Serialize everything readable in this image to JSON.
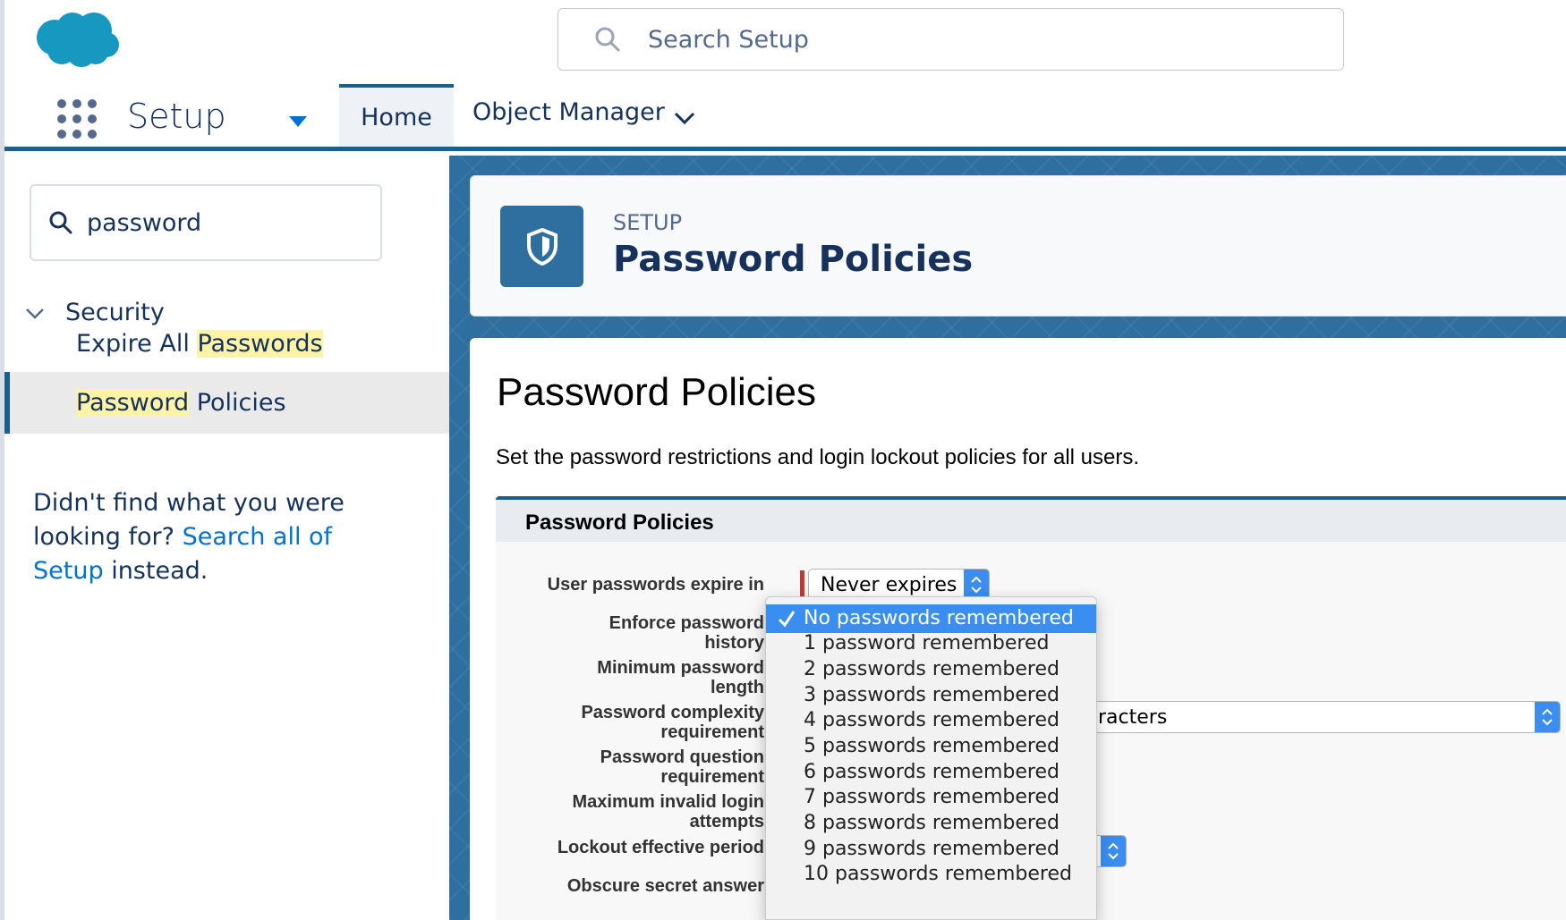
{
  "global_header": {
    "search_placeholder": "Search Setup"
  },
  "context_bar": {
    "app_name": "Setup",
    "tabs": [
      {
        "label": "Home"
      },
      {
        "label": "Object Manager"
      }
    ]
  },
  "sidebar": {
    "quickfind_value": "password",
    "tree": {
      "parent_label": "Security",
      "items": [
        {
          "pre": "Expire All ",
          "highlight": "Passwords",
          "post": ""
        },
        {
          "pre": "",
          "highlight": "Password",
          "post": " Policies"
        }
      ]
    },
    "not_found": {
      "prefix": "Didn't find what you were looking for?",
      "link": "Search all of Setup",
      "suffix": "instead."
    }
  },
  "page_header": {
    "eyebrow": "SETUP",
    "title": "Password Policies"
  },
  "content": {
    "title": "Password Policies",
    "description": "Set the password restrictions and login lockout policies for all users.",
    "section_title": "Password Policies",
    "fields": {
      "expire": "User passwords expire in",
      "history_1": "Enforce password",
      "history_2": "history",
      "min_len_1": "Minimum password",
      "min_len_2": "length",
      "complexity_1": "Password complexity",
      "complexity_2": "requirement",
      "question_1": "Password question",
      "question_2": "requirement",
      "invalid_1": "Maximum invalid login",
      "invalid_2": "attempts",
      "lockout": "Lockout effective period",
      "obscure": "Obscure secret answer"
    },
    "expire_value": "Never expires",
    "complexity_value_visible": "racters"
  },
  "dropdown": {
    "options": [
      "No passwords remembered",
      "1 password remembered",
      "2 passwords remembered",
      "3 passwords remembered",
      "4 passwords remembered",
      "5 passwords remembered",
      "6 passwords remembered",
      "7 passwords remembered",
      "8 passwords remembered",
      "9 passwords remembered",
      "10 passwords remembered"
    ],
    "selected_index": 0
  },
  "colors": {
    "brand_blue": "#1b5f8a",
    "link_blue": "#0070d2",
    "select_highlight": "#3a8ef0",
    "required_red": "#c23934",
    "search_highlight": "#fff3a5"
  }
}
